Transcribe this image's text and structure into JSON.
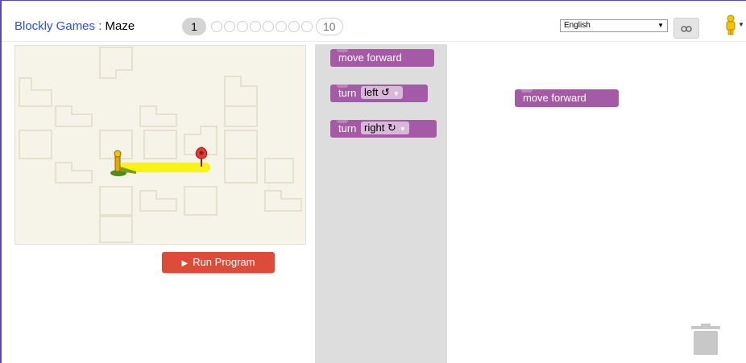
{
  "header": {
    "app_name": "Blockly Games",
    "separator": " : ",
    "game_name": "Maze",
    "levels": {
      "current": "1",
      "last": "10",
      "intermediate_count": 8
    }
  },
  "language": {
    "selected": "English"
  },
  "icons": {
    "link": "link-icon",
    "pegman": "pegman-icon",
    "trash": "trash-icon",
    "run": "play-icon"
  },
  "run_button": {
    "label": "Run Program"
  },
  "toolbox": {
    "blocks": [
      {
        "label": "move forward"
      },
      {
        "label": "turn",
        "dropdown": "left ↺"
      },
      {
        "label": "turn",
        "dropdown": "right ↻"
      }
    ]
  },
  "workspace": {
    "blocks": [
      {
        "label": "move forward"
      }
    ]
  },
  "colors": {
    "block": "#a55aa5",
    "run": "#dd4b39",
    "link": "#2f50c9",
    "path": "#f8f40a"
  }
}
